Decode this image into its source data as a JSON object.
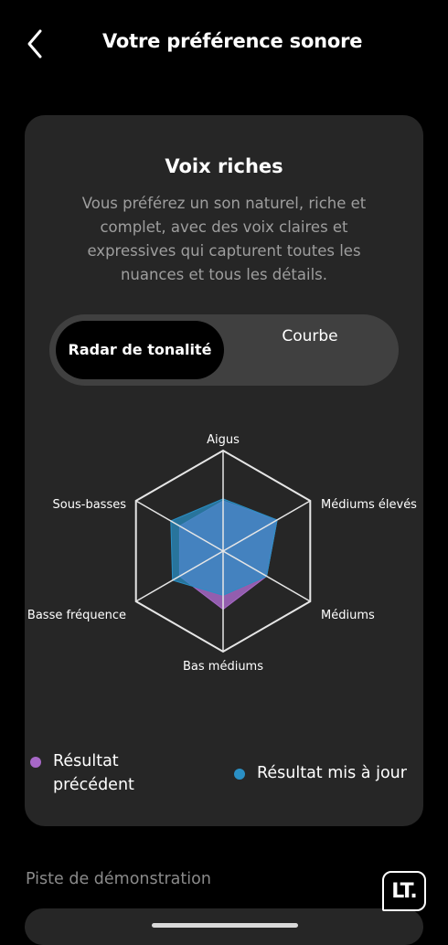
{
  "header": {
    "title": "Votre préférence sonore"
  },
  "card": {
    "title": "Voix riches",
    "description": "Vous préférez un son naturel, riche et complet, avec des voix claires et expressives qui capturent toutes les nuances et tous les détails.",
    "tabs": {
      "active": "Radar de tonalité",
      "inactive": "Courbe"
    },
    "legend": {
      "previous": "Résultat précédent",
      "updated": "Résultat mis à jour"
    }
  },
  "colors": {
    "previous": "#a768c7",
    "updated": "#2a8fc4"
  },
  "chart_data": {
    "type": "radar",
    "axes": [
      "Aigus",
      "Médiums élevés",
      "Médiums",
      "Bas médiums",
      "Basse fréquence",
      "Sous-basses"
    ],
    "range": [
      0,
      1
    ],
    "series": [
      {
        "name": "Résultat précédent",
        "values": [
          0.5,
          0.62,
          0.5,
          0.58,
          0.5,
          0.5
        ]
      },
      {
        "name": "Résultat mis à jour",
        "values": [
          0.52,
          0.62,
          0.5,
          0.44,
          0.58,
          0.6
        ]
      }
    ]
  },
  "demo": {
    "label": "Piste de démonstration",
    "logo": "LT."
  }
}
